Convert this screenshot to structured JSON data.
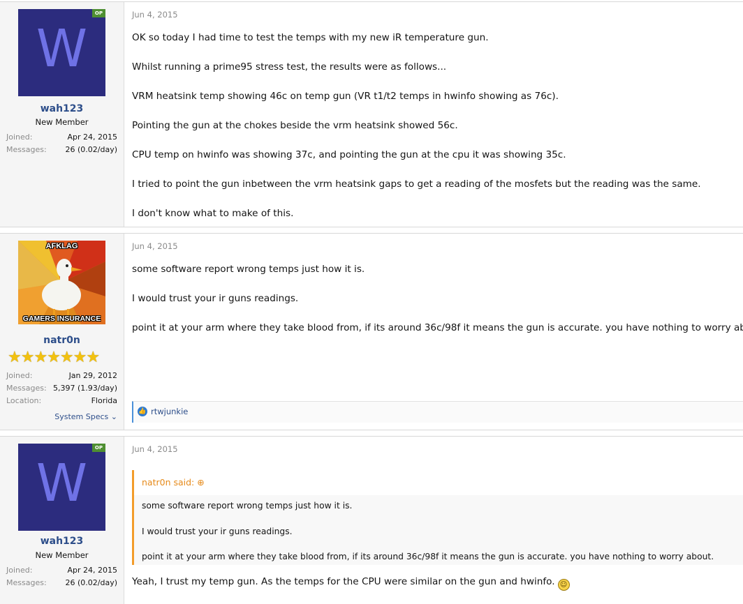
{
  "posts": [
    {
      "user": {
        "avatar_letter": "W",
        "op_badge": "OP",
        "name": "wah123",
        "title": "New Member",
        "stats": [
          {
            "label": "Joined:",
            "value": "Apr 24, 2015"
          },
          {
            "label": "Messages:",
            "value": "26 (0.02/day)"
          }
        ]
      },
      "date": "Jun 4, 2015",
      "paragraphs": [
        "OK so today I had time to test the temps with my new iR temperature gun.",
        "Whilst running a prime95 stress test, the results were as follows...",
        "VRM heatsink temp showing 46c on temp gun (VR t1/t2 temps in hwinfo showing as 76c).",
        "Pointing the gun at the chokes beside the vrm heatsink showed 56c.",
        "CPU temp on hwinfo was showing 37c, and pointing the gun at the cpu it was showing 35c.",
        "I tried to point the gun inbetween the vrm heatsink gaps to get a reading of the mosfets but the reading was the same.",
        "I don't know what to make of this."
      ]
    },
    {
      "user": {
        "avatar_top_text": "AFKLAG",
        "avatar_bottom_text": "GAMERS INSURANCE",
        "name": "natr0n",
        "stars": "★★★★★★★",
        "stats": [
          {
            "label": "Joined:",
            "value": "Jan 29, 2012"
          },
          {
            "label": "Messages:",
            "value": "5,397 (1.93/day)"
          },
          {
            "label": "Location:",
            "value": "Florida"
          }
        ],
        "specs": "System Specs ⌄"
      },
      "date": "Jun 4, 2015",
      "paragraphs": [
        "some software report wrong temps just how it is.",
        "I would trust your ir guns readings.",
        "point it at your arm where they take blood from, if its around 36c/98f it means the gun is accurate. you have nothing to worry about."
      ],
      "reaction": {
        "icon": "👍",
        "user": "rtwjunkie"
      }
    },
    {
      "user": {
        "avatar_letter": "W",
        "op_badge": "OP",
        "name": "wah123",
        "title": "New Member",
        "stats": [
          {
            "label": "Joined:",
            "value": "Apr 24, 2015"
          },
          {
            "label": "Messages:",
            "value": "26 (0.02/day)"
          }
        ]
      },
      "date": "Jun 4, 2015",
      "quote": {
        "author": "natr0n said: ⊕",
        "lines": [
          "some software report wrong temps just how it is.",
          "I would trust your ir guns readings.",
          "point it at your arm where they take blood from, if its around 36c/98f it means the gun is accurate. you have nothing to worry about."
        ]
      },
      "paragraphs": [
        "Yeah, I trust my temp gun. As the temps for the CPU were similar on the gun and hwinfo."
      ],
      "smiley": "☺"
    }
  ]
}
